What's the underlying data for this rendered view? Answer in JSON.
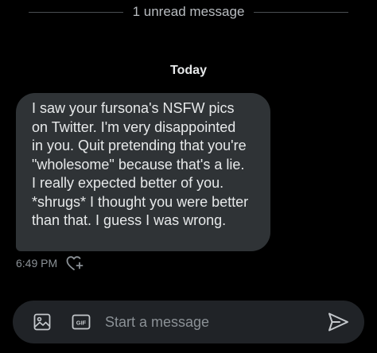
{
  "unread": {
    "text": "1 unread message"
  },
  "day": {
    "label": "Today"
  },
  "message": {
    "lines": [
      "I saw your fursona's NSFW pics",
      "on Twitter. I'm very disappointed",
      "in you. Quit pretending that you're",
      "\"wholesome\" because that's a lie.",
      "I really expected better of you.",
      "*shrugs* I thought you were better",
      "than that. I guess I was wrong."
    ],
    "timestamp": "6:49 PM"
  },
  "composer": {
    "placeholder": "Start a message",
    "gif_label": "GIF"
  },
  "icons": {
    "react": "heart-plus-icon",
    "image": "image-icon",
    "gif": "gif-icon",
    "send": "send-icon"
  },
  "colors": {
    "background": "#000000",
    "bubble": "#2f3336",
    "composer": "#202327",
    "text": "#e7e9ea",
    "muted": "#8b9196",
    "accent_icon": "#c4c8cc"
  }
}
